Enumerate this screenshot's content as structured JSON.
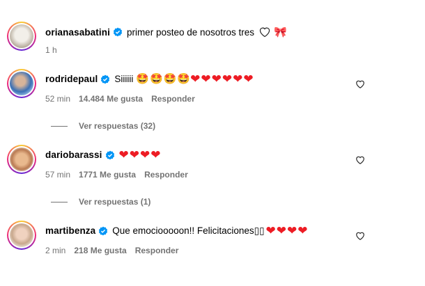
{
  "post": {
    "username": "orianasabatini",
    "caption": "primer posteo de nosotros tres",
    "time": "1 h"
  },
  "comments": [
    {
      "username": "rodridepaul",
      "text": "Siiiiii",
      "emojis": [
        "🤩",
        "🤩",
        "🤩",
        "🤩"
      ],
      "hearts": 6,
      "time": "52 min",
      "likes": "14.484 Me gusta",
      "reply_label": "Responder",
      "view_replies": "Ver respuestas (32)"
    },
    {
      "username": "dariobarassi",
      "text": "",
      "hearts": 4,
      "time": "57 min",
      "likes": "1771 Me gusta",
      "reply_label": "Responder",
      "view_replies": "Ver respuestas (1)"
    },
    {
      "username": "martibenza",
      "text": "Que emociooooon!! Felicitaciones▯▯",
      "hearts": 4,
      "time": "2 min",
      "likes": "218 Me gusta",
      "reply_label": "Responder"
    }
  ],
  "colors": {
    "verified": "#0095f6",
    "heart": "#ed1c24",
    "muted": "#737373"
  }
}
